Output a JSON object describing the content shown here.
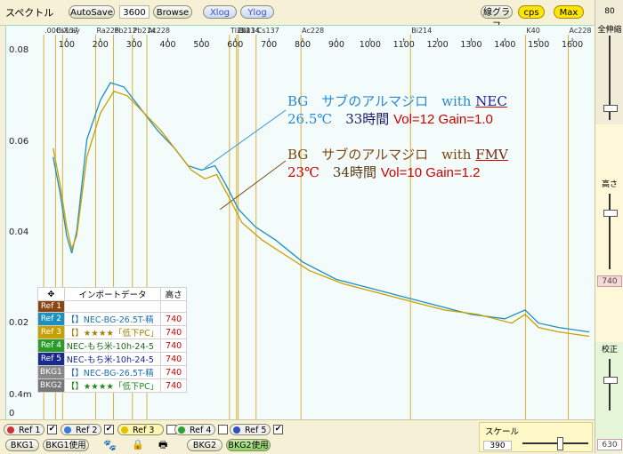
{
  "toolbar": {
    "title": "スペクトル",
    "autosave_label": "AutoSave",
    "autosave_value": "3600",
    "browse_label": "Browse",
    "xlog_label": "Xlog",
    "ylog_label": "Ylog",
    "line_graph_label": "線グラフ",
    "cps_label": "cps",
    "max_label": "Max"
  },
  "right_panel": {
    "top_value": "80",
    "fit_label": "全伸縮",
    "height_label": "高さ",
    "height_value": "740",
    "calib_label": "校正",
    "calib_value": "630"
  },
  "annotations": {
    "nec_line1_a": "BG　サブのアルマジロ　with",
    "nec_line1_b": "NEC",
    "nec_line2_a": "26.5℃",
    "nec_line2_b": "　33時間",
    "nec_line2_c": "Vol=12 Gain=1.0",
    "fmv_line1_a": "BG　サブのアルマジロ　with",
    "fmv_line1_b": "FMV",
    "fmv_line2_a": "23℃",
    "fmv_line2_b": "　34時間",
    "fmv_line2_c": "Vol=10 Gain=1.2"
  },
  "import_table": {
    "header_import": "インポートデータ",
    "header_height": "高さ",
    "rows": [
      {
        "tag": "Ref 1",
        "name": "",
        "value": "",
        "color": "#8b4513"
      },
      {
        "tag": "Ref 2",
        "name": "【】NEC-BG-26.5T-精",
        "value": "740",
        "color": "#1e90c0"
      },
      {
        "tag": "Ref 3",
        "name": "【】★★★★「低下PC」",
        "value": "740",
        "color": "#c8a000"
      },
      {
        "tag": "Ref 4",
        "name": "NEC-もち米-10h-24-5",
        "value": "740",
        "color": "#2a9a2a"
      },
      {
        "tag": "Ref 5",
        "name": "NEC-もち米-10h-24-5",
        "value": "740",
        "color": "#1a2a8a"
      },
      {
        "tag": "BKG1",
        "name": "【】NEC-BG-26.5T-精",
        "value": "740",
        "color": "#888888"
      },
      {
        "tag": "BKG2",
        "name": "【】★★★★「低下PC」",
        "value": "740",
        "color": "#777777"
      }
    ]
  },
  "bottom": {
    "refs": [
      {
        "label": "Ref 1",
        "color": "#d03030",
        "checked": "✔"
      },
      {
        "label": "Ref 2",
        "color": "#3a7ad0",
        "checked": "✔"
      },
      {
        "label": "Ref 3",
        "color": "#e8c000",
        "checked": ""
      },
      {
        "label": "Ref 4",
        "color": "#30a030",
        "checked": ""
      },
      {
        "label": "Ref 5",
        "color": "#3050c0",
        "checked": "✔"
      }
    ],
    "bkg1_label": "BKG1",
    "bkg1_use_label": "BKG1使用",
    "bkg2_label": "BKG2",
    "bkg2_use_label": "BKG2使用",
    "scale_label": "スケール",
    "scale_value": "390"
  },
  "chart_data": {
    "type": "line",
    "x_range": [
      0,
      1650
    ],
    "y_range": [
      0,
      0.09
    ],
    "x_ticks": [
      "100",
      "200",
      "300",
      "400",
      "500",
      "600",
      "700",
      "800",
      "900",
      "1000",
      "1100",
      "1200",
      "1300",
      "1400",
      "1500",
      "1600"
    ],
    "y_ticks": [
      "0.08",
      "0.06",
      "0.04",
      "0.02",
      "0.4m",
      "0"
    ],
    "isotopes": [
      {
        "label": ".00Cs137",
        "x": 32
      },
      {
        "label": "Bi",
        "x": 67
      },
      {
        "label": "Xray",
        "x": 88
      },
      {
        "label": "Ra226",
        "x": 186
      },
      {
        "label": "Pb212",
        "x": 239
      },
      {
        "label": "Pb214",
        "x": 295
      },
      {
        "label": "Ac228",
        "x": 338
      },
      {
        "label": "Bi214",
        "x": 609
      },
      {
        "label": "Tl208",
        "x": 583
      },
      {
        "label": "Cs134",
        "x": 604
      },
      {
        "label": "Cs137",
        "x": 662
      },
      {
        "label": "Ac228",
        "x": 795
      },
      {
        "label": "Bi214",
        "x": 1120
      },
      {
        "label": "K40",
        "x": 1461
      },
      {
        "label": "Ac228",
        "x": 1588
      }
    ],
    "series": [
      {
        "name": "Ref 2",
        "color": "#1e90c0",
        "points": [
          [
            60,
            0.06
          ],
          [
            80,
            0.052
          ],
          [
            100,
            0.042
          ],
          [
            115,
            0.038
          ],
          [
            130,
            0.043
          ],
          [
            160,
            0.064
          ],
          [
            200,
            0.073
          ],
          [
            230,
            0.077
          ],
          [
            270,
            0.076
          ],
          [
            320,
            0.071
          ],
          [
            370,
            0.066
          ],
          [
            420,
            0.062
          ],
          [
            460,
            0.058
          ],
          [
            500,
            0.057
          ],
          [
            540,
            0.058
          ],
          [
            570,
            0.054
          ],
          [
            610,
            0.048
          ],
          [
            660,
            0.044
          ],
          [
            720,
            0.041
          ],
          [
            800,
            0.036
          ],
          [
            900,
            0.032
          ],
          [
            1000,
            0.03
          ],
          [
            1100,
            0.028
          ],
          [
            1200,
            0.026
          ],
          [
            1300,
            0.024
          ],
          [
            1400,
            0.023
          ],
          [
            1460,
            0.025
          ],
          [
            1500,
            0.022
          ],
          [
            1560,
            0.021
          ],
          [
            1650,
            0.02
          ]
        ]
      },
      {
        "name": "Ref 3",
        "color": "#c8a000",
        "points": [
          [
            60,
            0.062
          ],
          [
            80,
            0.054
          ],
          [
            100,
            0.044
          ],
          [
            115,
            0.039
          ],
          [
            130,
            0.042
          ],
          [
            160,
            0.06
          ],
          [
            200,
            0.07
          ],
          [
            240,
            0.075
          ],
          [
            280,
            0.074
          ],
          [
            330,
            0.07
          ],
          [
            380,
            0.066
          ],
          [
            430,
            0.061
          ],
          [
            470,
            0.057
          ],
          [
            510,
            0.055
          ],
          [
            545,
            0.056
          ],
          [
            580,
            0.051
          ],
          [
            620,
            0.045
          ],
          [
            680,
            0.041
          ],
          [
            740,
            0.038
          ],
          [
            820,
            0.034
          ],
          [
            920,
            0.031
          ],
          [
            1020,
            0.029
          ],
          [
            1120,
            0.027
          ],
          [
            1220,
            0.025
          ],
          [
            1320,
            0.024
          ],
          [
            1420,
            0.022
          ],
          [
            1460,
            0.024
          ],
          [
            1500,
            0.021
          ],
          [
            1560,
            0.02
          ],
          [
            1650,
            0.019
          ]
        ]
      }
    ]
  }
}
